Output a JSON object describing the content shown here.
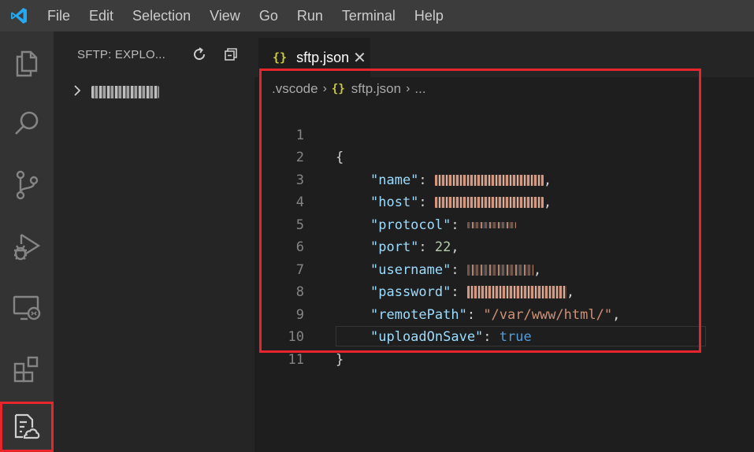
{
  "menu": {
    "items": [
      "File",
      "Edit",
      "Selection",
      "View",
      "Go",
      "Run",
      "Terminal",
      "Help"
    ]
  },
  "sidebar": {
    "title": "SFTP: EXPLO...",
    "tree_item_label": "cdsocolo"
  },
  "editor": {
    "tab_label": "sftp.json",
    "breadcrumb": [
      ".vscode",
      "sftp.json",
      "..."
    ],
    "line_numbers": [
      "1",
      "2",
      "3",
      "4",
      "5",
      "6",
      "7",
      "8",
      "9",
      "10",
      "11"
    ],
    "code": {
      "open_brace": "{",
      "close_brace": "}",
      "name_key": "\"name\"",
      "host_key": "\"host\"",
      "protocol_key": "\"protocol\"",
      "port_key": "\"port\"",
      "port_value": "22",
      "username_key": "\"username\"",
      "password_key": "\"password\"",
      "remotepath_key": "\"remotePath\"",
      "remotepath_value": "\"/var/www/html/\"",
      "uploadonsave_key": "\"uploadOnSave\"",
      "uploadonsave_value": "true",
      "colon": ": ",
      "comma": ","
    }
  },
  "colors": {
    "highlight": "#e8242c",
    "json_key": "#9cdcfe",
    "json_string": "#ce9178",
    "json_number": "#b5cea8",
    "json_bool": "#569cd6"
  },
  "icons": [
    "vscode-logo-icon",
    "explorer-icon",
    "search-icon",
    "source-control-icon",
    "run-debug-icon",
    "remote-explorer-icon",
    "extensions-icon",
    "sftp-icon",
    "refresh-icon",
    "collapse-all-icon",
    "chevron-right-icon",
    "close-icon",
    "json-icon"
  ]
}
